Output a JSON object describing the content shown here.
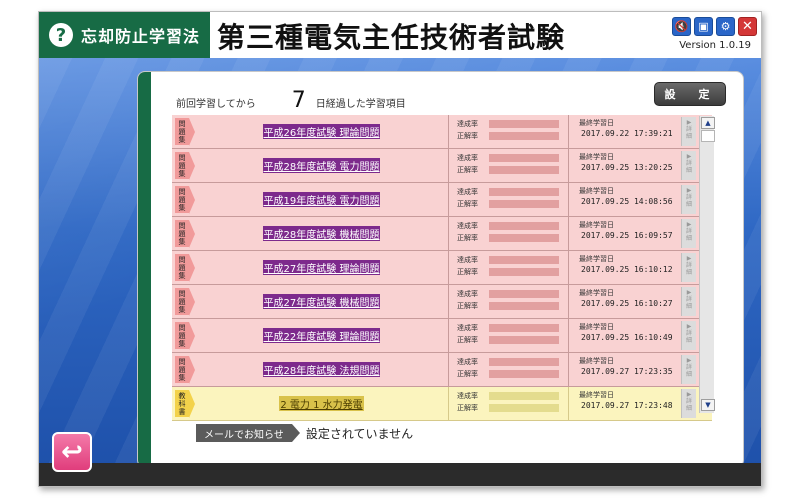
{
  "header": {
    "logo_text": "忘却防止学習法",
    "logo_mark": "?",
    "app_title": "第三種電気主任技術者試験",
    "version": "Version 1.0.19",
    "icons": [
      "mute-icon",
      "cube-icon",
      "gear-icon",
      "close-icon"
    ]
  },
  "summary": {
    "prefix": "前回学習してから",
    "days": "7",
    "suffix": "日経過した学習項目"
  },
  "settings_button": "設　定",
  "columns": {
    "rate1": "達成率",
    "rate2": "正解率",
    "last_date": "最終学習日",
    "detail": "詳細"
  },
  "rows": [
    {
      "category": "問題集",
      "title": "平成26年度試験 理論問題",
      "date": "2017.09.22 17:39:21",
      "variant": "pink"
    },
    {
      "category": "問題集",
      "title": "平成28年度試験 電力問題",
      "date": "2017.09.25 13:20:25",
      "variant": "pink"
    },
    {
      "category": "問題集",
      "title": "平成19年度試験 電力問題",
      "date": "2017.09.25 14:08:56",
      "variant": "pink"
    },
    {
      "category": "問題集",
      "title": "平成28年度試験 機械問題",
      "date": "2017.09.25 16:09:57",
      "variant": "pink"
    },
    {
      "category": "問題集",
      "title": "平成27年度試験 理論問題",
      "date": "2017.09.25 16:10:12",
      "variant": "pink"
    },
    {
      "category": "問題集",
      "title": "平成27年度試験 機械問題",
      "date": "2017.09.25 16:10:27",
      "variant": "pink"
    },
    {
      "category": "問題集",
      "title": "平成22年度試験 理論問題",
      "date": "2017.09.25 16:10:49",
      "variant": "pink"
    },
    {
      "category": "問題集",
      "title": "平成28年度試験 法規問題",
      "date": "2017.09.27 17:23:35",
      "variant": "pink"
    },
    {
      "category": "教科書",
      "title": "2 電力 1 水力発電",
      "date": "2017.09.27 17:23:48",
      "variant": "yellow"
    }
  ],
  "mail": {
    "tag": "メールでお知らせ",
    "text": "設定されていません"
  },
  "colors": {
    "brand_green": "#176b45",
    "row_pink": "#f9d2d2",
    "row_yellow": "#fbf4be",
    "back_button": "#e03d7c"
  }
}
